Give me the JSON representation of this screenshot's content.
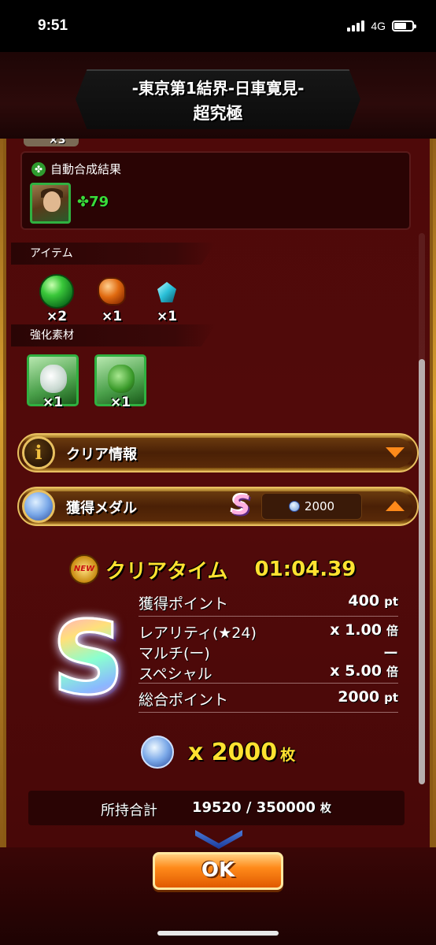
{
  "status_bar": {
    "time": "9:51",
    "network": "4G"
  },
  "title": {
    "line1": "-東京第1結界-日車寛見-",
    "line2": "超究極"
  },
  "peek": {
    "qty": "×3"
  },
  "auto_synthesis": {
    "label": "自動合成結果",
    "clover_count": "79"
  },
  "items_section": {
    "title": "アイテム",
    "items": [
      {
        "icon": "green-orb-icon",
        "qty": "×2"
      },
      {
        "icon": "orange-crystal-icon",
        "qty": "×1"
      },
      {
        "icon": "cyan-gem-icon",
        "qty": "×1"
      }
    ]
  },
  "materials_section": {
    "title": "強化素材",
    "items": [
      {
        "icon": "white-creature-icon",
        "qty": "×1"
      },
      {
        "icon": "green-creature-icon",
        "qty": "×1"
      }
    ]
  },
  "clear_info_bar": {
    "label": "クリア情報"
  },
  "medal_bar": {
    "label": "獲得メダル",
    "rank": "S",
    "medals": "2000"
  },
  "clear_time": {
    "badge": "NEW",
    "label": "クリアタイム",
    "value": "01:04.39"
  },
  "rank_big": "S",
  "stats": {
    "points_label": "獲得ポイント",
    "points_value": "400",
    "points_unit": "pt",
    "rarity_label": "レアリティ(★24)",
    "rarity_value": "x 1.00",
    "rarity_unit": "倍",
    "multi_label": "マルチ(ー)",
    "multi_value": "ー",
    "special_label": "スペシャル",
    "special_value": "x 5.00",
    "special_unit": "倍",
    "total_label": "総合ポイント",
    "total_value": "2000",
    "total_unit": "pt"
  },
  "total_medals": {
    "value": "x 2000",
    "unit": "枚"
  },
  "owned": {
    "label": "所持合計",
    "value": "19520 / 350000",
    "unit": "枚"
  },
  "ok_button": "OK",
  "colors": {
    "accent_gold": "#ffe230",
    "button_orange": "#ff8a1a",
    "panel_red": "#4e0909",
    "rarity_green": "#30b040"
  }
}
